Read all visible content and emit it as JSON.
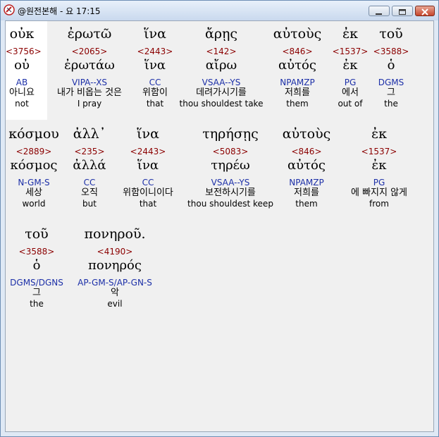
{
  "window": {
    "title": "@원전본해 - 요 17:15"
  },
  "rows": [
    [
      {
        "greek": "οὐκ",
        "strong": "<3756>",
        "lemma": "οὐ",
        "parse": "AB",
        "korean": "아니요",
        "english": "not"
      },
      {
        "greek": "ἐρωτῶ",
        "strong": "<2065>",
        "lemma": "ἐρωτάω",
        "parse": "VIPA--XS",
        "korean": "내가 비옵는 것은",
        "english": "I pray"
      },
      {
        "greek": "ἵνα",
        "strong": "<2443>",
        "lemma": "ἵνα",
        "parse": "CC",
        "korean": "위함이",
        "english": "that"
      },
      {
        "greek": "ἄρῃς",
        "strong": "<142>",
        "lemma": "αἴρω",
        "parse": "VSAA--YS",
        "korean": "데려가시기를",
        "english": "thou shouldest take"
      },
      {
        "greek": "αὐτοὺς",
        "strong": "<846>",
        "lemma": "αὐτός",
        "parse": "NPAMZP",
        "korean": "저희를",
        "english": "them"
      },
      {
        "greek": "ἐκ",
        "strong": "<1537>",
        "lemma": "ἐκ",
        "parse": "PG",
        "korean": "에서",
        "english": "out of"
      },
      {
        "greek": "τοῦ",
        "strong": "<3588>",
        "lemma": "ὁ",
        "parse": "DGMS",
        "korean": "그",
        "english": "the"
      }
    ],
    [
      {
        "greek": "κόσμου",
        "strong": "<2889>",
        "lemma": "κόσμος",
        "parse": "N-GM-S",
        "korean": "세상",
        "english": "world"
      },
      {
        "greek": "ἀλλ᾽",
        "strong": "<235>",
        "lemma": "ἀλλά",
        "parse": "CC",
        "korean": "오직",
        "english": "but"
      },
      {
        "greek": "ἵνα",
        "strong": "<2443>",
        "lemma": "ἵνα",
        "parse": "CC",
        "korean": "위함이니이다",
        "english": "that"
      },
      {
        "greek": "τηρήσῃς",
        "strong": "<5083>",
        "lemma": "τηρέω",
        "parse": "VSAA--YS",
        "korean": "보전하시기를",
        "english": "thou shouldest keep"
      },
      {
        "greek": "αὐτοὺς",
        "strong": "<846>",
        "lemma": "αὐτός",
        "parse": "NPAMZP",
        "korean": "저희를",
        "english": "them"
      },
      {
        "greek": "ἐκ",
        "strong": "<1537>",
        "lemma": "ἐκ",
        "parse": "PG",
        "korean": "에 빠지지 않게",
        "english": "from"
      }
    ],
    [
      {
        "greek": "τοῦ",
        "strong": "<3588>",
        "lemma": "ὁ",
        "parse": "DGMS/DGNS",
        "korean": "그",
        "english": "the"
      },
      {
        "greek": "πονηροῦ.",
        "strong": "<4190>",
        "lemma": "πονηρός",
        "parse": "AP-GM-S/AP-GN-S",
        "korean": "악",
        "english": "evil"
      }
    ]
  ]
}
